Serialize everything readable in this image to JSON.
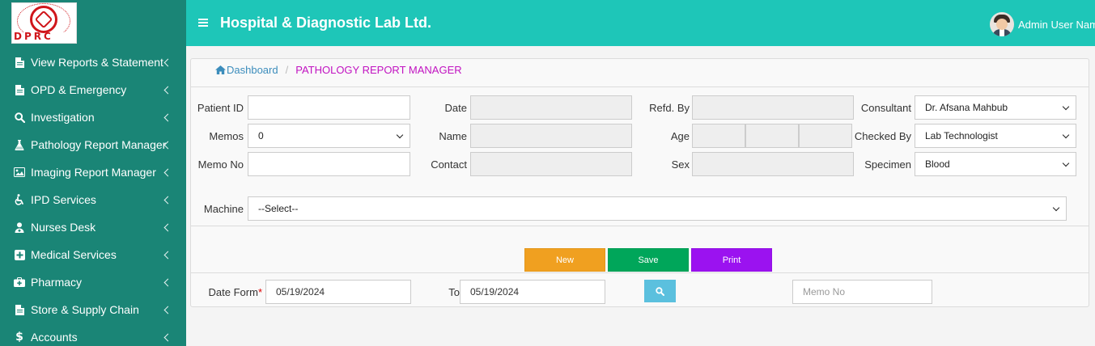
{
  "logo": {
    "text": "DPRC"
  },
  "sidebar": {
    "items": [
      {
        "label": "View Reports & Statement",
        "icon": "file-icon"
      },
      {
        "label": "OPD & Emergency",
        "icon": "file-icon"
      },
      {
        "label": "Investigation",
        "icon": "search-icon"
      },
      {
        "label": "Pathology Report Manager",
        "icon": "flask-icon"
      },
      {
        "label": "Imaging Report Manager",
        "icon": "image-icon"
      },
      {
        "label": "IPD Services",
        "icon": "wheelchair-icon"
      },
      {
        "label": "Nurses Desk",
        "icon": "user-md-icon"
      },
      {
        "label": "Medical Services",
        "icon": "plus-square-icon"
      },
      {
        "label": "Pharmacy",
        "icon": "medkit-icon"
      },
      {
        "label": "Store & Supply Chain",
        "icon": "file-icon"
      },
      {
        "label": "Accounts",
        "icon": "dollar-icon"
      }
    ]
  },
  "header": {
    "title": "Hospital & Diagnostic Lab Ltd.",
    "user_name": "Admin User Name"
  },
  "breadcrumb": {
    "home": "Dashboard",
    "separator": "/",
    "current": "PATHOLOGY REPORT MANAGER"
  },
  "form": {
    "patient_id": {
      "label": "Patient ID",
      "value": ""
    },
    "memos": {
      "label": "Memos",
      "value": "0"
    },
    "memo_no": {
      "label": "Memo No",
      "value": ""
    },
    "date": {
      "label": "Date",
      "value": ""
    },
    "name": {
      "label": "Name",
      "value": ""
    },
    "contact": {
      "label": "Contact",
      "value": ""
    },
    "refd_by": {
      "label": "Refd. By",
      "value": ""
    },
    "age": {
      "label": "Age",
      "values": [
        "",
        "",
        ""
      ]
    },
    "sex": {
      "label": "Sex",
      "value": ""
    },
    "consultant": {
      "label": "Consultant",
      "value": "Dr. Afsana Mahbub"
    },
    "checked_by": {
      "label": "Checked By",
      "value": "Lab Technologist"
    },
    "specimen": {
      "label": "Specimen",
      "value": "Blood"
    },
    "machine": {
      "label": "Machine",
      "value": "--Select--"
    }
  },
  "buttons": {
    "new": {
      "label": "New",
      "color": "#f0a020"
    },
    "save": {
      "label": "Save",
      "color": "#00a65a"
    },
    "print": {
      "label": "Print",
      "color": "#9b12f0"
    }
  },
  "filter": {
    "date_from": {
      "label": "Date Form",
      "required_mark": "*",
      "value": "05/19/2024"
    },
    "to": {
      "label": "To",
      "value": "05/19/2024"
    },
    "memo_no": {
      "placeholder": "Memo No"
    }
  },
  "colors": {
    "sidebar": "#1a8576",
    "topbar": "#1ec6b8",
    "breadcrumb_link": "#3c8dbc",
    "breadcrumb_current": "#c113c1",
    "search_button": "#5bc0de"
  }
}
